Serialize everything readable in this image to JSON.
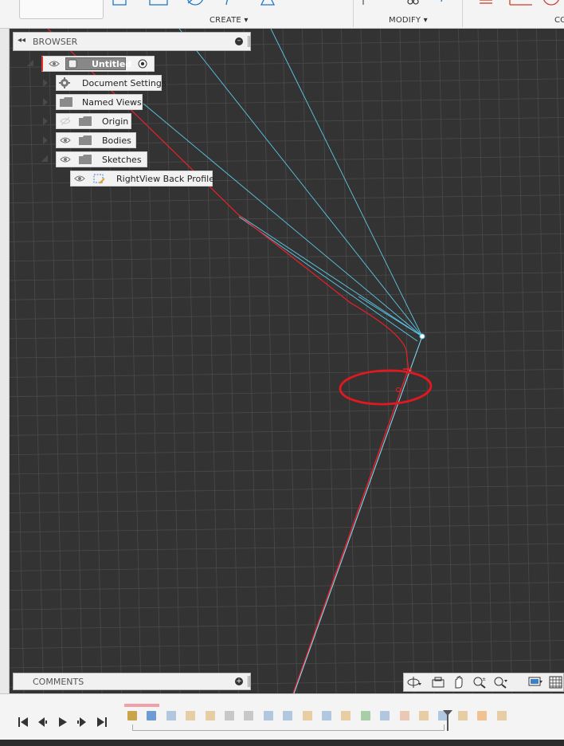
{
  "toolbar": {
    "groups": [
      {
        "label": "CREATE ▾"
      },
      {
        "label": "MODIFY ▾"
      },
      {
        "label": "CO"
      }
    ],
    "accent": "#1f78c8",
    "constraint_color": "#d23b2b"
  },
  "browser": {
    "title": "BROWSER",
    "root": {
      "label": "Untitled"
    },
    "items": [
      {
        "label": "Document Settings",
        "icon": "gear-icon"
      },
      {
        "label": "Named Views",
        "icon": "folder-icon"
      },
      {
        "label": "Origin",
        "icon": "folder-icon",
        "hidden": true
      },
      {
        "label": "Bodies",
        "icon": "folder-icon"
      },
      {
        "label": "Sketches",
        "icon": "folder-icon",
        "expanded": true
      }
    ],
    "sketch": {
      "label": "RightView Back Profile",
      "icon": "sketch-icon"
    }
  },
  "comments": {
    "title": "COMMENTS"
  },
  "canvas": {
    "background": "#333333",
    "grid_color": "#4a4a4a",
    "sketch_line_color": "#5bc8e8",
    "profile_line_color": "#e8202a",
    "annotation_color": "#e0181f"
  },
  "navbar": {
    "icons": [
      "orbit-icon",
      "look-at-icon",
      "pan-icon",
      "zoom-window-icon",
      "zoom-icon",
      "display-settings-icon",
      "grid-icon"
    ]
  },
  "timeline": {
    "controls": [
      "go-to-start-icon",
      "step-back-icon",
      "play-icon",
      "step-forward-icon",
      "go-to-end-icon"
    ],
    "features": [
      {
        "icon": "component-icon",
        "color": "#c9a44a"
      },
      {
        "icon": "sketch-icon",
        "color": "#3f7fc7"
      },
      {
        "icon": "sketch-icon",
        "color": "#9ab8d8"
      },
      {
        "icon": "extrude-icon",
        "color": "#e2c08a"
      },
      {
        "icon": "extrude-icon",
        "color": "#e2c08a"
      },
      {
        "icon": "scissors-icon",
        "color": "#b9b9b9"
      },
      {
        "icon": "scissors-icon",
        "color": "#b9b9b9"
      },
      {
        "icon": "sketch-icon",
        "color": "#9ab8d8"
      },
      {
        "icon": "sketch-icon",
        "color": "#9ab8d8"
      },
      {
        "icon": "extrude-icon",
        "color": "#e2c08a"
      },
      {
        "icon": "sketch-icon",
        "color": "#9ab8d8"
      },
      {
        "icon": "extrude-icon",
        "color": "#e2c08a"
      },
      {
        "icon": "split-icon",
        "color": "#8fc28f"
      },
      {
        "icon": "sketch-icon",
        "color": "#9ab8d8"
      },
      {
        "icon": "fillet-icon",
        "color": "#e8b9a0"
      },
      {
        "icon": "shell-icon",
        "color": "#e2c08a"
      },
      {
        "icon": "mirror-icon",
        "color": "#9ab8d8"
      },
      {
        "icon": "offset-icon",
        "color": "#e2c08a"
      },
      {
        "icon": "extrude-icon",
        "color": "#f0b070"
      },
      {
        "icon": "extrude-icon",
        "color": "#e2c08a"
      }
    ]
  }
}
